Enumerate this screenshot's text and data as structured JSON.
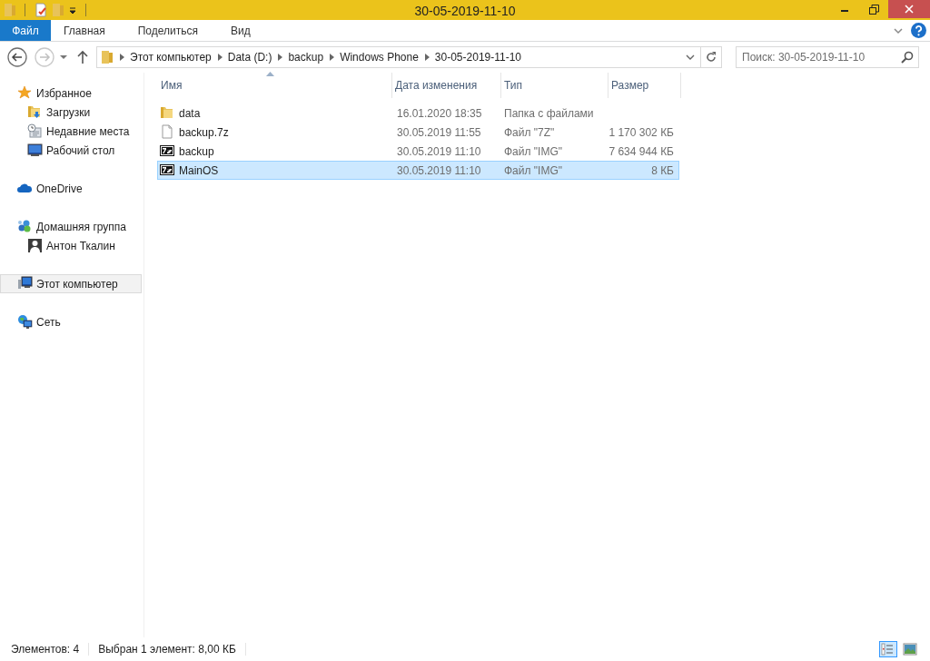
{
  "window": {
    "title": "30-05-2019-11-10"
  },
  "ribbon": {
    "file_tab": "Файл",
    "tabs": [
      {
        "label": "Главная"
      },
      {
        "label": "Поделиться"
      },
      {
        "label": "Вид"
      }
    ]
  },
  "address": {
    "breadcrumbs": [
      "Этот компьютер",
      "Data (D:)",
      "backup",
      "Windows Phone",
      "30-05-2019-11-10"
    ]
  },
  "search": {
    "placeholder": "Поиск: 30-05-2019-11-10"
  },
  "sidebar": {
    "groups": [
      {
        "label": "Избранное",
        "kind": "star",
        "selected": false,
        "children": [
          {
            "label": "Загрузки",
            "kind": "downloads",
            "selected": false
          },
          {
            "label": "Недавние места",
            "kind": "recent",
            "selected": false
          },
          {
            "label": "Рабочий стол",
            "kind": "desktop",
            "selected": false
          }
        ]
      },
      {
        "label": "OneDrive",
        "kind": "cloud",
        "selected": false
      },
      {
        "label": "Домашняя группа",
        "kind": "homegroup",
        "selected": false,
        "children": [
          {
            "label": "Антон Ткалин",
            "kind": "user",
            "selected": false
          }
        ]
      },
      {
        "label": "Этот компьютер",
        "kind": "computer",
        "selected": true
      },
      {
        "label": "Сеть",
        "kind": "network",
        "selected": false
      }
    ]
  },
  "table": {
    "columns": [
      {
        "label": "Имя",
        "sorted": true
      },
      {
        "label": "Дата изменения",
        "sorted": false
      },
      {
        "label": "Тип",
        "sorted": false
      },
      {
        "label": "Размер",
        "sorted": false
      }
    ],
    "rows": [
      {
        "name": "data",
        "date": "16.01.2020 18:35",
        "type": "Папка с файлами",
        "kind": "folder",
        "selected": false
      },
      {
        "name": "backup.7z",
        "date": "30.05.2019 11:55",
        "type": "Файл \"7Z\"",
        "size": "1 170 302 КБ",
        "kind": "file",
        "selected": false
      },
      {
        "name": "backup",
        "date": "30.05.2019 11:10",
        "type": "Файл \"IMG\"",
        "size": "7 634 944 КБ",
        "kind": "archive",
        "selected": false
      },
      {
        "name": "MainOS",
        "date": "30.05.2019 11:10",
        "type": "Файл \"IMG\"",
        "size": "8 КБ",
        "kind": "archive",
        "selected": true
      }
    ]
  },
  "status_bar": {
    "items": "Элементов: 4",
    "selection": "Выбран 1 элемент: 8,00 КБ"
  },
  "view_buttons": [
    {
      "kind": "details",
      "selected": true
    },
    {
      "kind": "thumbnails",
      "selected": false
    }
  ]
}
